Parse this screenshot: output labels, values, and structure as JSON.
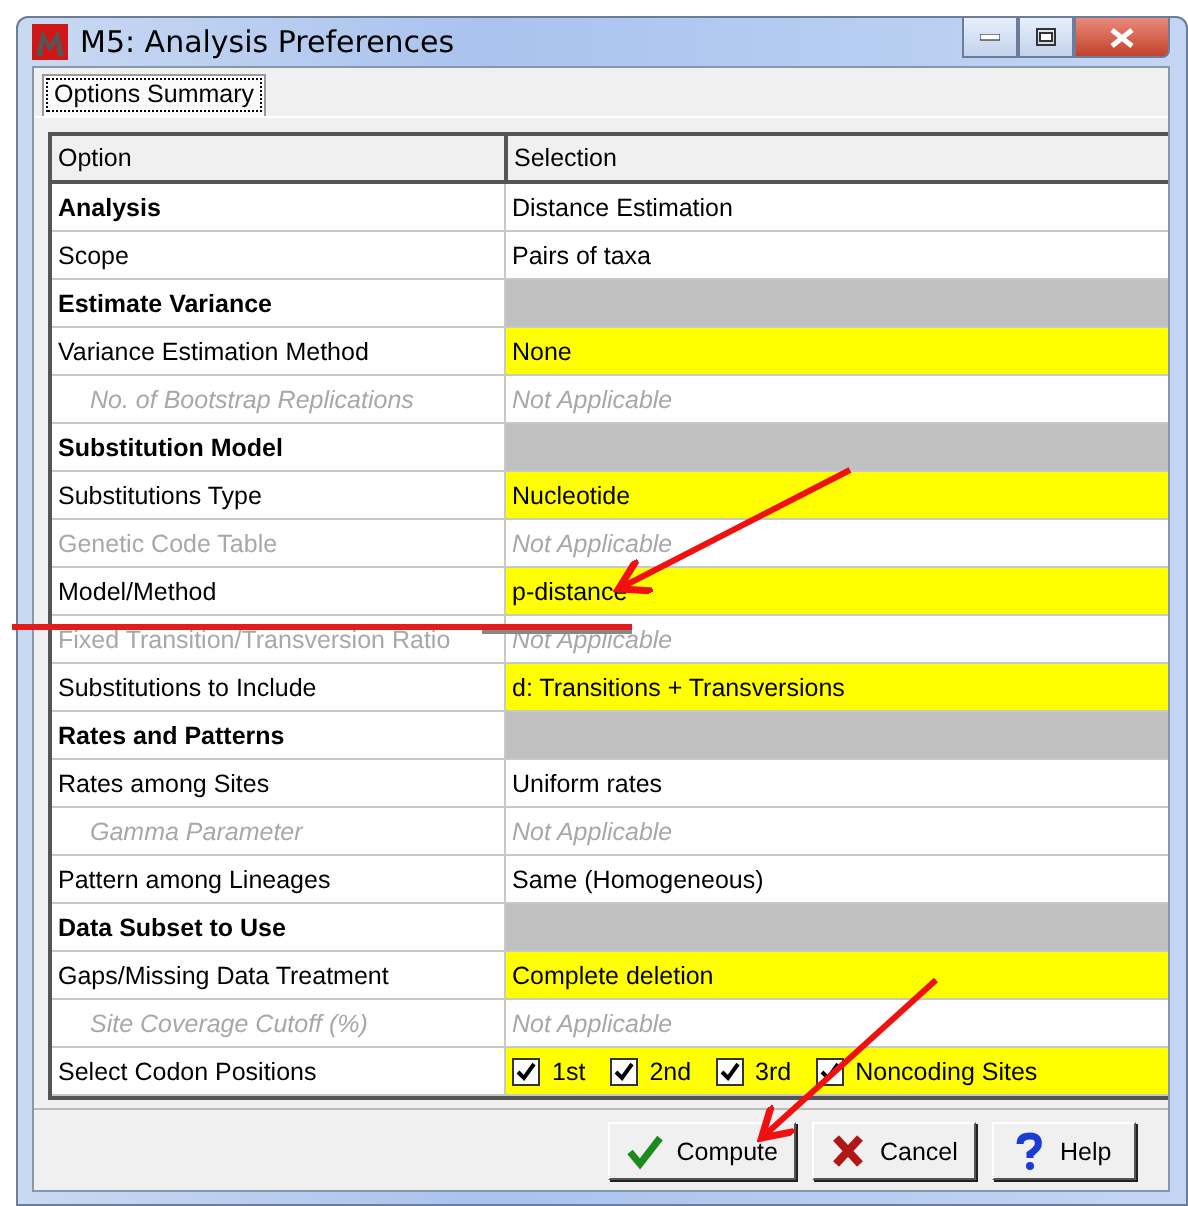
{
  "window": {
    "title": "M5: Analysis Preferences"
  },
  "tabs": [
    {
      "label": "Options Summary",
      "selected": true
    }
  ],
  "table": {
    "columns": [
      "Option",
      "Selection"
    ],
    "rows": [
      {
        "option": "Analysis",
        "bold": true,
        "disabled": false,
        "indented": false,
        "selection": {
          "kind": "text",
          "text": "Distance Estimation",
          "highlighted": false
        }
      },
      {
        "option": "Scope",
        "bold": false,
        "disabled": false,
        "indented": false,
        "selection": {
          "kind": "text",
          "text": "Pairs of taxa",
          "highlighted": false
        }
      },
      {
        "option": "Estimate Variance",
        "bold": true,
        "disabled": false,
        "indented": false,
        "selection": {
          "kind": "blank"
        }
      },
      {
        "option": "Variance Estimation Method",
        "bold": false,
        "disabled": false,
        "indented": false,
        "selection": {
          "kind": "text",
          "text": "None",
          "highlighted": true
        }
      },
      {
        "option": "No. of Bootstrap Replications",
        "bold": false,
        "disabled": true,
        "indented": true,
        "selection": {
          "kind": "text",
          "text": "Not Applicable",
          "highlighted": false
        }
      },
      {
        "option": "Substitution Model",
        "bold": true,
        "disabled": false,
        "indented": false,
        "selection": {
          "kind": "blank"
        }
      },
      {
        "option": "Substitutions Type",
        "bold": false,
        "disabled": false,
        "indented": false,
        "selection": {
          "kind": "text",
          "text": "Nucleotide",
          "highlighted": true
        }
      },
      {
        "option": "Genetic Code Table",
        "bold": false,
        "disabled": true,
        "indented": false,
        "selection": {
          "kind": "text",
          "text": "Not Applicable",
          "highlighted": false
        }
      },
      {
        "option": "Model/Method",
        "bold": false,
        "disabled": false,
        "indented": false,
        "selection": {
          "kind": "text",
          "text": "p-distance",
          "highlighted": true
        }
      },
      {
        "option": "Fixed Transition/Transversion Ratio",
        "bold": false,
        "disabled": true,
        "indented": false,
        "selection": {
          "kind": "text",
          "text": "Not Applicable",
          "highlighted": false
        }
      },
      {
        "option": "Substitutions to Include",
        "bold": false,
        "disabled": false,
        "indented": false,
        "selection": {
          "kind": "text",
          "text": "d: Transitions + Transversions",
          "highlighted": true
        }
      },
      {
        "option": "Rates and Patterns",
        "bold": true,
        "disabled": false,
        "indented": false,
        "selection": {
          "kind": "blank"
        }
      },
      {
        "option": "Rates among Sites",
        "bold": false,
        "disabled": false,
        "indented": false,
        "selection": {
          "kind": "text",
          "text": "Uniform rates",
          "highlighted": false
        }
      },
      {
        "option": "Gamma Parameter",
        "bold": false,
        "disabled": true,
        "indented": true,
        "selection": {
          "kind": "text",
          "text": "Not Applicable",
          "highlighted": false
        }
      },
      {
        "option": "Pattern among Lineages",
        "bold": false,
        "disabled": false,
        "indented": false,
        "selection": {
          "kind": "text",
          "text": "Same (Homogeneous)",
          "highlighted": false
        }
      },
      {
        "option": "Data Subset to Use",
        "bold": true,
        "disabled": false,
        "indented": false,
        "selection": {
          "kind": "blank"
        }
      },
      {
        "option": "Gaps/Missing Data Treatment",
        "bold": false,
        "disabled": false,
        "indented": false,
        "selection": {
          "kind": "text",
          "text": "Complete deletion",
          "highlighted": true
        }
      },
      {
        "option": "Site Coverage Cutoff (%)",
        "bold": false,
        "disabled": true,
        "indented": true,
        "selection": {
          "kind": "text",
          "text": "Not Applicable",
          "highlighted": false
        }
      },
      {
        "option": "Select Codon Positions",
        "bold": false,
        "disabled": false,
        "indented": false,
        "selection": {
          "kind": "checks",
          "highlighted": true,
          "checks": [
            {
              "label": "1st",
              "checked": true
            },
            {
              "label": "2nd",
              "checked": true
            },
            {
              "label": "3rd",
              "checked": true
            },
            {
              "label": "Noncoding Sites",
              "checked": true
            }
          ]
        }
      }
    ]
  },
  "buttons": [
    {
      "label": "Compute",
      "kind": "ok"
    },
    {
      "label": "Cancel",
      "kind": "cancel"
    },
    {
      "label": "Help",
      "kind": "help"
    }
  ]
}
